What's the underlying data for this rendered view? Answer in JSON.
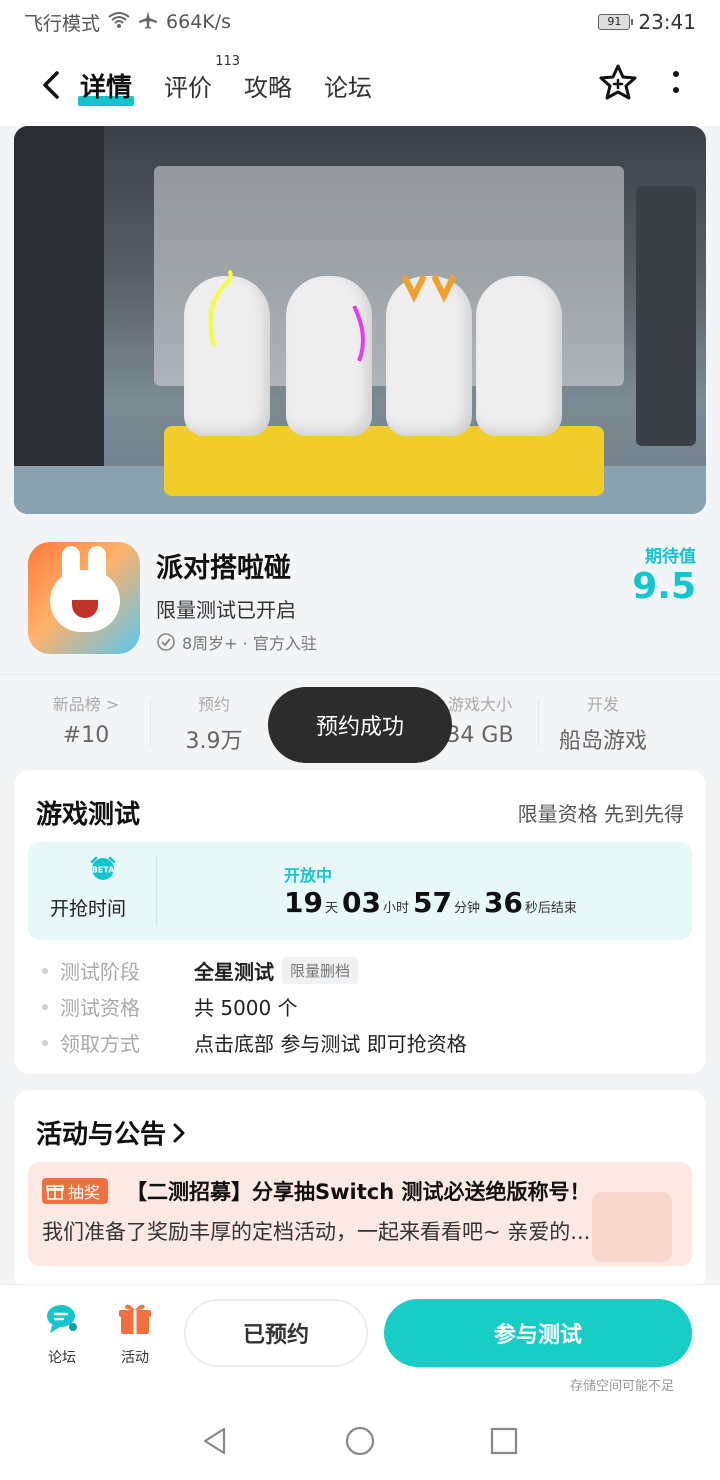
{
  "status_bar": {
    "mode": "飞行模式",
    "speed": "664K/s",
    "battery": "91",
    "time": "23:41"
  },
  "header": {
    "tabs": [
      {
        "label": "详情",
        "active": true
      },
      {
        "label": "评价",
        "count": "113"
      },
      {
        "label": "攻略"
      },
      {
        "label": "论坛"
      }
    ],
    "back_icon": "chevron-left-icon",
    "favorite_icon": "star-plus-icon",
    "more_icon": "more-vertical-icon"
  },
  "game": {
    "title": "派对搭啦碰",
    "status": "限量测试已开启",
    "meta": "8周岁+ · 官方入驻",
    "expect_label": "期待值",
    "expect_value": "9.5"
  },
  "stats": [
    {
      "label": "新品榜 >",
      "value": "#10"
    },
    {
      "label": "预约",
      "value": "3.9万"
    },
    {
      "label": "游戏大小",
      "value": "34 GB"
    },
    {
      "label": "开发",
      "value": "船岛游戏"
    }
  ],
  "toast": "预约成功",
  "test": {
    "title": "游戏测试",
    "subtitle": "限量资格 先到先得",
    "time_label": "开抢时间",
    "open_label": "开放中",
    "countdown": {
      "days": "19",
      "days_unit": "天",
      "hours": "03",
      "hours_unit": "小时",
      "minutes": "57",
      "minutes_unit": "分钟",
      "seconds": "36",
      "seconds_unit": "秒后结束"
    },
    "beta_icon": "BETA",
    "details": [
      {
        "label": "测试阶段",
        "value": "全星测试",
        "tag": "限量删档"
      },
      {
        "label": "测试资格",
        "value": "共 5000 个"
      },
      {
        "label": "领取方式",
        "value": "点击底部 参与测试 即可抢资格"
      }
    ]
  },
  "activity": {
    "title": "活动与公告",
    "tag": "抽奖",
    "headline": "【二测招募】分享抽Switch 测试必送绝版称号！",
    "body": "我们准备了奖励丰厚的定档活动，一起来看看吧~ 亲爱的..."
  },
  "bottom_bar": {
    "forum_label": "论坛",
    "activity_label": "活动",
    "reserved_label": "已预约",
    "join_label": "参与测试",
    "storage_note": "存储空间可能不足"
  },
  "colors": {
    "accent": "#15c5ce",
    "join_button": "#17cdc5",
    "activity_orange": "#f0703e",
    "toast_bg": "#2c2c2c"
  }
}
